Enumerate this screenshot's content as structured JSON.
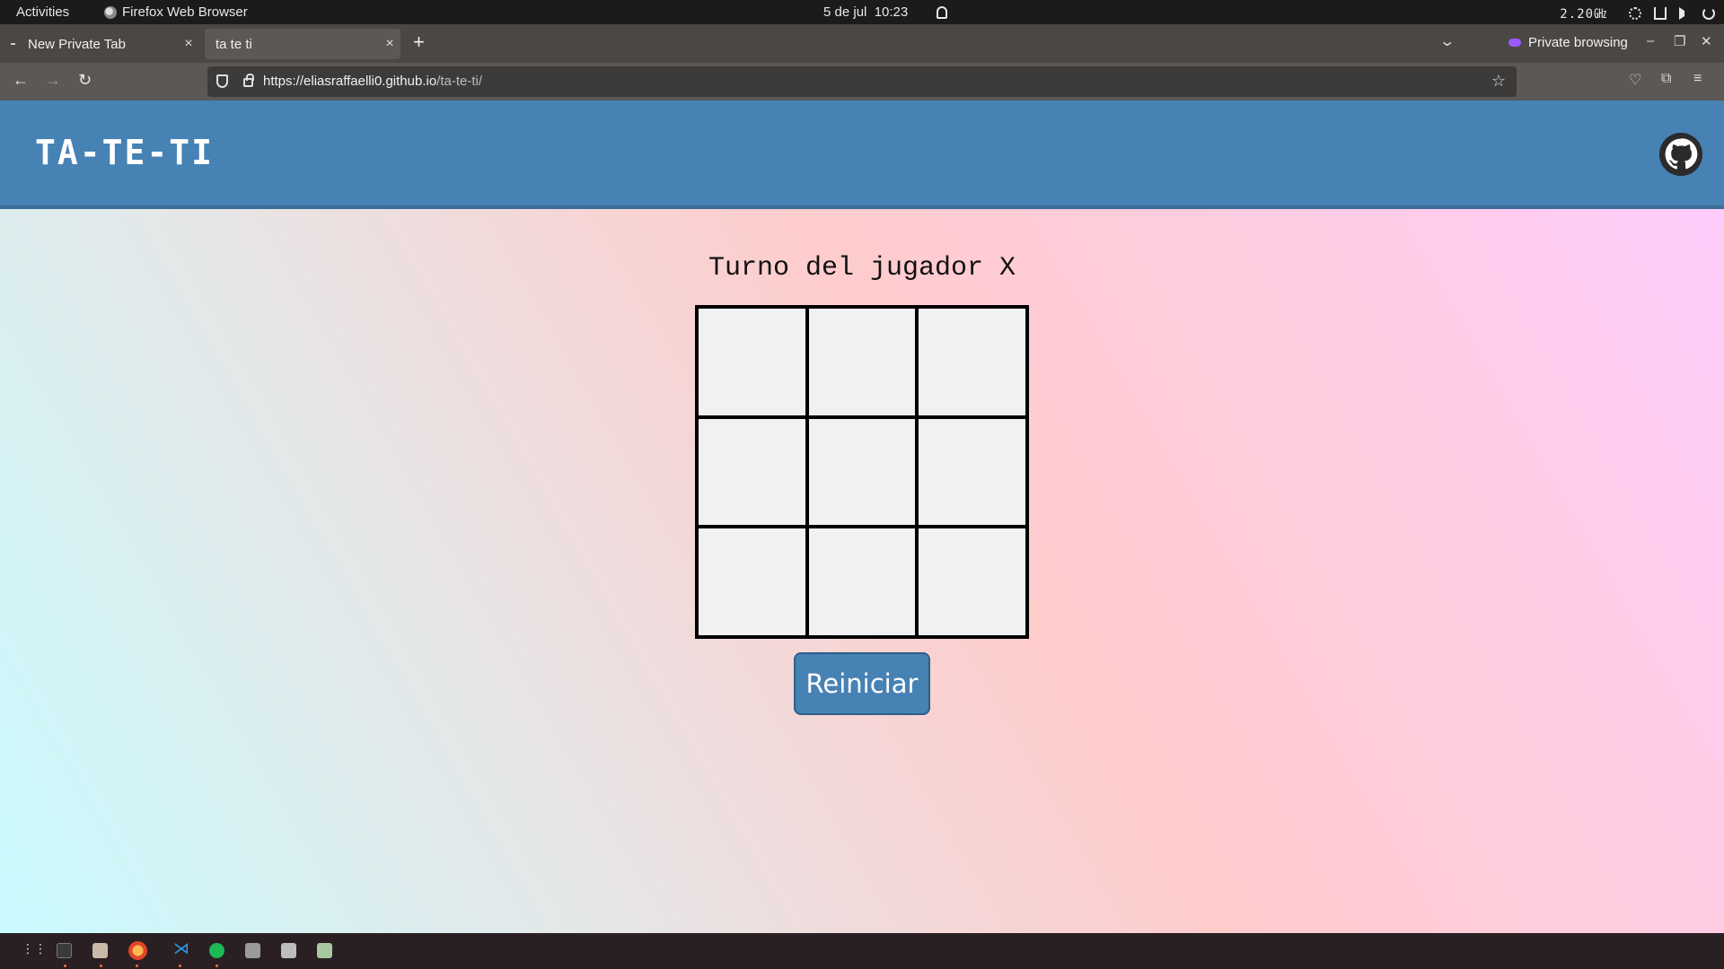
{
  "topbar": {
    "activities": "Activities",
    "app_name": "Firefox Web Browser",
    "datetime": "5 de jul  10:23",
    "cpu": "2.20㎓"
  },
  "tabs": [
    {
      "label": "New Private Tab"
    },
    {
      "label": "ta te ti"
    }
  ],
  "browser": {
    "private_label": "Private browsing",
    "url_host": "https://eliasraffaelli0.github.io",
    "url_path": "/ta-te-ti/"
  },
  "page": {
    "site_title": "TA-TE-TI",
    "turn_text": "Turno del jugador X",
    "restart_label": "Reiniciar",
    "board": [
      "",
      "",
      "",
      "",
      "",
      "",
      "",
      "",
      ""
    ]
  },
  "icons": {
    "github": "github-icon",
    "private": "private-mask-icon"
  },
  "colors": {
    "header": "#4682b4",
    "button": "#4682b4",
    "cell": "#f1f1f1"
  }
}
